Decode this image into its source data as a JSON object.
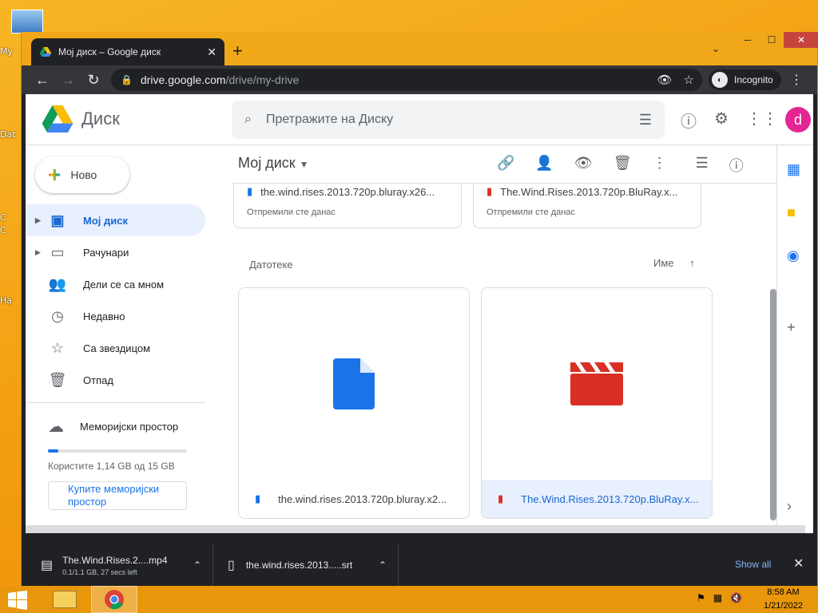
{
  "desktop": {
    "icon_labels": [
      "My",
      "Dat",
      "C",
      "C",
      "Ha"
    ]
  },
  "browser": {
    "tab_title": "Мој диск – Google диск",
    "url_host": "drive.google.com",
    "url_path": "/drive/my-drive",
    "incognito_label": "Incognito"
  },
  "drive": {
    "app_name": "Диск",
    "search_placeholder": "Претражите на Диску",
    "avatar_letter": "d",
    "new_label": "Ново",
    "nav": [
      {
        "label": "Мој диск",
        "icon": "my-drive-icon",
        "active": true
      },
      {
        "label": "Рачунари",
        "icon": "computers-icon"
      },
      {
        "label": "Дели се са мном",
        "icon": "shared-icon"
      },
      {
        "label": "Недавно",
        "icon": "clock-icon"
      },
      {
        "label": "Са звездицом",
        "icon": "star-icon"
      },
      {
        "label": "Отпад",
        "icon": "trash-icon"
      }
    ],
    "storage": {
      "title": "Меморијски простор",
      "used_text": "Користите 1,14 GB од 15 GB",
      "used_fraction": 0.076,
      "buy_label": "Купите меморијски простор"
    },
    "main_title": "Мој диск",
    "suggested": [
      {
        "name": "the.wind.rises.2013.720p.bluray.x26...",
        "sub": "Отпремили сте данас",
        "type": "doc"
      },
      {
        "name": "The.Wind.Rises.2013.720p.BluRay.x...",
        "sub": "Отпремили сте данас",
        "type": "video"
      }
    ],
    "files_heading": "Датотеке",
    "sort_label": "Име",
    "files": [
      {
        "name": "the.wind.rises.2013.720p.bluray.x2...",
        "type": "doc",
        "selected": false
      },
      {
        "name": "The.Wind.Rises.2013.720p.BluRay.x...",
        "type": "video",
        "selected": true
      }
    ],
    "colors": {
      "doc": "#1a73e8",
      "video": "#d93025",
      "accent": "#1967d2"
    }
  },
  "downloads": {
    "items": [
      {
        "name": "The.Wind.Rises.2....mp4",
        "status": "0.1/1.1 GB, 27 secs left"
      },
      {
        "name": "the.wind.rises.2013.....srt",
        "status": ""
      }
    ],
    "show_all": "Show all"
  },
  "taskbar": {
    "time": "8:58 AM",
    "date": "1/21/2022"
  }
}
